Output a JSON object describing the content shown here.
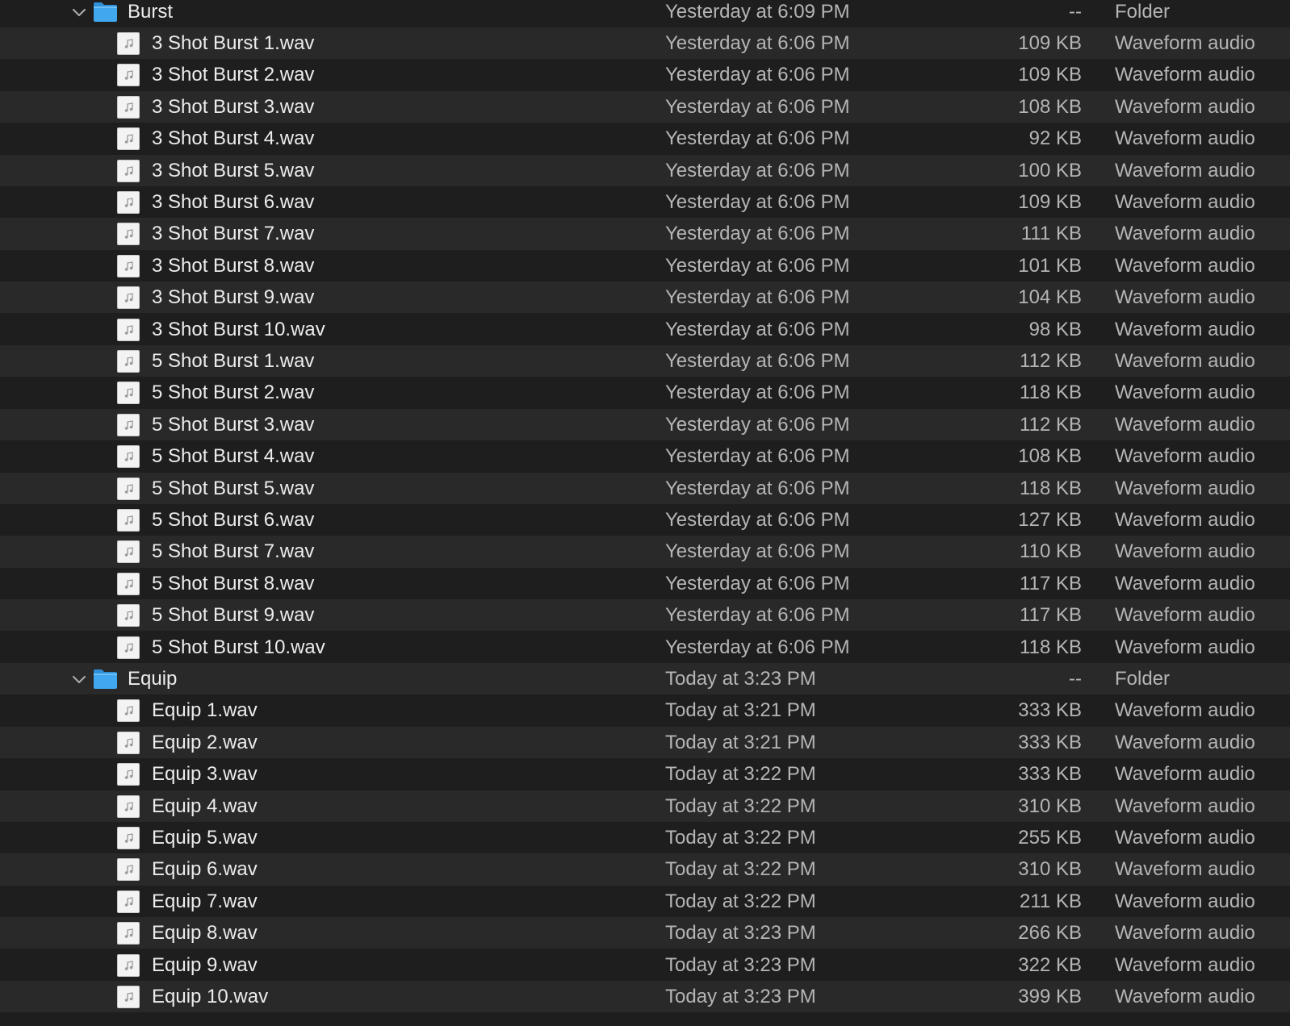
{
  "colors": {
    "background": "#1e1e1e",
    "row_alt": "#292929",
    "folder_blue": "#41a7ef",
    "name_text": "#ececec",
    "secondary_text": "#b5b5b5"
  },
  "icons": {
    "folder": "folder-icon",
    "audio_file": "audio-file-icon",
    "disclosure": "chevron-down-icon"
  },
  "rows": [
    {
      "type": "folder",
      "name": "Burst",
      "date": "Yesterday at 6:09 PM",
      "size": "--",
      "kind": "Folder"
    },
    {
      "type": "file",
      "name": "3 Shot Burst 1.wav",
      "date": "Yesterday at 6:06 PM",
      "size": "109 KB",
      "kind": "Waveform audio"
    },
    {
      "type": "file",
      "name": "3 Shot Burst 2.wav",
      "date": "Yesterday at 6:06 PM",
      "size": "109 KB",
      "kind": "Waveform audio"
    },
    {
      "type": "file",
      "name": "3 Shot Burst 3.wav",
      "date": "Yesterday at 6:06 PM",
      "size": "108 KB",
      "kind": "Waveform audio"
    },
    {
      "type": "file",
      "name": "3 Shot Burst 4.wav",
      "date": "Yesterday at 6:06 PM",
      "size": "92 KB",
      "kind": "Waveform audio"
    },
    {
      "type": "file",
      "name": "3 Shot Burst 5.wav",
      "date": "Yesterday at 6:06 PM",
      "size": "100 KB",
      "kind": "Waveform audio"
    },
    {
      "type": "file",
      "name": "3 Shot Burst 6.wav",
      "date": "Yesterday at 6:06 PM",
      "size": "109 KB",
      "kind": "Waveform audio"
    },
    {
      "type": "file",
      "name": "3 Shot Burst 7.wav",
      "date": "Yesterday at 6:06 PM",
      "size": "111 KB",
      "kind": "Waveform audio"
    },
    {
      "type": "file",
      "name": "3 Shot Burst 8.wav",
      "date": "Yesterday at 6:06 PM",
      "size": "101 KB",
      "kind": "Waveform audio"
    },
    {
      "type": "file",
      "name": "3 Shot Burst 9.wav",
      "date": "Yesterday at 6:06 PM",
      "size": "104 KB",
      "kind": "Waveform audio"
    },
    {
      "type": "file",
      "name": "3 Shot Burst 10.wav",
      "date": "Yesterday at 6:06 PM",
      "size": "98 KB",
      "kind": "Waveform audio"
    },
    {
      "type": "file",
      "name": "5 Shot Burst 1.wav",
      "date": "Yesterday at 6:06 PM",
      "size": "112 KB",
      "kind": "Waveform audio"
    },
    {
      "type": "file",
      "name": "5 Shot Burst 2.wav",
      "date": "Yesterday at 6:06 PM",
      "size": "118 KB",
      "kind": "Waveform audio"
    },
    {
      "type": "file",
      "name": "5 Shot Burst 3.wav",
      "date": "Yesterday at 6:06 PM",
      "size": "112 KB",
      "kind": "Waveform audio"
    },
    {
      "type": "file",
      "name": "5 Shot Burst 4.wav",
      "date": "Yesterday at 6:06 PM",
      "size": "108 KB",
      "kind": "Waveform audio"
    },
    {
      "type": "file",
      "name": "5 Shot Burst 5.wav",
      "date": "Yesterday at 6:06 PM",
      "size": "118 KB",
      "kind": "Waveform audio"
    },
    {
      "type": "file",
      "name": "5 Shot Burst 6.wav",
      "date": "Yesterday at 6:06 PM",
      "size": "127 KB",
      "kind": "Waveform audio"
    },
    {
      "type": "file",
      "name": "5 Shot Burst 7.wav",
      "date": "Yesterday at 6:06 PM",
      "size": "110 KB",
      "kind": "Waveform audio"
    },
    {
      "type": "file",
      "name": "5 Shot Burst 8.wav",
      "date": "Yesterday at 6:06 PM",
      "size": "117 KB",
      "kind": "Waveform audio"
    },
    {
      "type": "file",
      "name": "5 Shot Burst 9.wav",
      "date": "Yesterday at 6:06 PM",
      "size": "117 KB",
      "kind": "Waveform audio"
    },
    {
      "type": "file",
      "name": "5 Shot Burst 10.wav",
      "date": "Yesterday at 6:06 PM",
      "size": "118 KB",
      "kind": "Waveform audio"
    },
    {
      "type": "folder",
      "name": "Equip",
      "date": "Today at 3:23 PM",
      "size": "--",
      "kind": "Folder"
    },
    {
      "type": "file",
      "name": "Equip 1.wav",
      "date": "Today at 3:21 PM",
      "size": "333 KB",
      "kind": "Waveform audio"
    },
    {
      "type": "file",
      "name": "Equip 2.wav",
      "date": "Today at 3:21 PM",
      "size": "333 KB",
      "kind": "Waveform audio"
    },
    {
      "type": "file",
      "name": "Equip 3.wav",
      "date": "Today at 3:22 PM",
      "size": "333 KB",
      "kind": "Waveform audio"
    },
    {
      "type": "file",
      "name": "Equip 4.wav",
      "date": "Today at 3:22 PM",
      "size": "310 KB",
      "kind": "Waveform audio"
    },
    {
      "type": "file",
      "name": "Equip 5.wav",
      "date": "Today at 3:22 PM",
      "size": "255 KB",
      "kind": "Waveform audio"
    },
    {
      "type": "file",
      "name": "Equip 6.wav",
      "date": "Today at 3:22 PM",
      "size": "310 KB",
      "kind": "Waveform audio"
    },
    {
      "type": "file",
      "name": "Equip 7.wav",
      "date": "Today at 3:22 PM",
      "size": "211 KB",
      "kind": "Waveform audio"
    },
    {
      "type": "file",
      "name": "Equip 8.wav",
      "date": "Today at 3:23 PM",
      "size": "266 KB",
      "kind": "Waveform audio"
    },
    {
      "type": "file",
      "name": "Equip 9.wav",
      "date": "Today at 3:23 PM",
      "size": "322 KB",
      "kind": "Waveform audio"
    },
    {
      "type": "file",
      "name": "Equip 10.wav",
      "date": "Today at 3:23 PM",
      "size": "399 KB",
      "kind": "Waveform audio"
    }
  ]
}
